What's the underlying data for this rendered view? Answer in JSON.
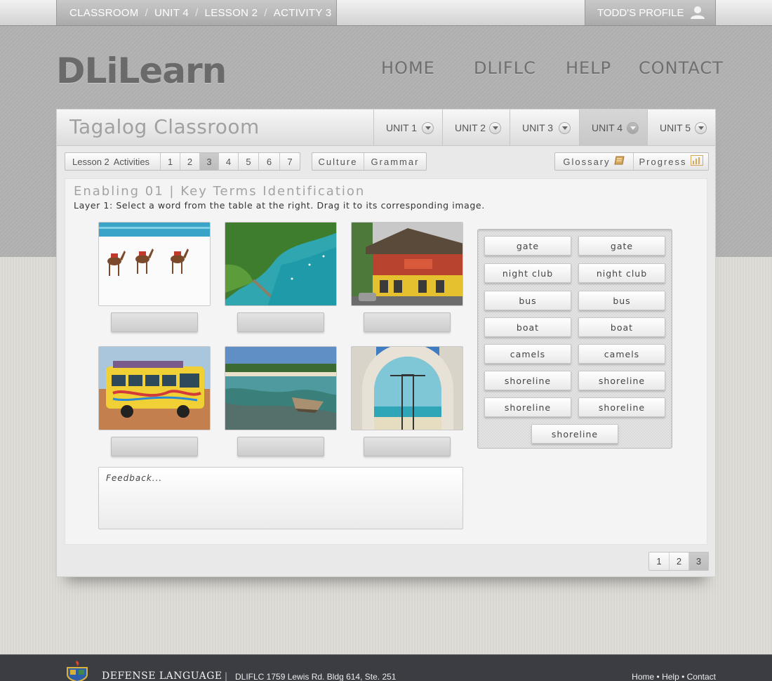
{
  "breadcrumb": [
    "CLASSROOM",
    "UNIT 4",
    "LESSON 2",
    "ACTIVITY 3"
  ],
  "breadcrumb_separator": "/",
  "profile_label": "TODD'S PROFILE",
  "logo": "DLiLearn",
  "main_nav": [
    "HOME",
    "DLIFLC",
    "HELP",
    "CONTACT"
  ],
  "classroom_title": "Tagalog Classroom",
  "units": {
    "tabs": [
      "UNIT 1",
      "UNIT 2",
      "UNIT 3",
      "UNIT 4",
      "UNIT 5"
    ],
    "active": "UNIT 4"
  },
  "lesson_bar": {
    "label_lesson": "Lesson 2",
    "label_activities": "Activities",
    "activities": [
      "1",
      "2",
      "3",
      "4",
      "5",
      "6",
      "7"
    ],
    "active_activity": "3"
  },
  "section_tabs": [
    "Culture",
    "Grammar"
  ],
  "tools": {
    "glossary": "Glossary",
    "progress": "Progress"
  },
  "activity": {
    "title": "Enabling 01 | Key Terms Identification",
    "instructions": "Layer 1: Select a word from the table at the right. Drag it to its corresponding image.",
    "images": [
      "camels",
      "shoreline",
      "night club",
      "bus",
      "boat",
      "gate"
    ]
  },
  "feedback_placeholder": "Feedback...",
  "word_bank": [
    "gate",
    "gate",
    "night club",
    "night club",
    "bus",
    "bus",
    "boat",
    "boat",
    "camels",
    "camels",
    "shoreline",
    "shoreline",
    "shoreline",
    "shoreline",
    "shoreline"
  ],
  "pagination": {
    "pages": [
      "1",
      "2",
      "3"
    ],
    "active": "3"
  },
  "footer": {
    "org": "DEFENSE LANGUAGE",
    "divider": "|",
    "address": "DLIFLC 1759 Lewis Rd. Bldg 614, Ste. 251",
    "links": [
      "Home",
      "Help",
      "Contact"
    ],
    "link_separator": "•"
  },
  "colors": {
    "accent": "#6a6a6a",
    "footer_bg": "#3b3d42",
    "panel_bg": "#e9e9e9"
  }
}
